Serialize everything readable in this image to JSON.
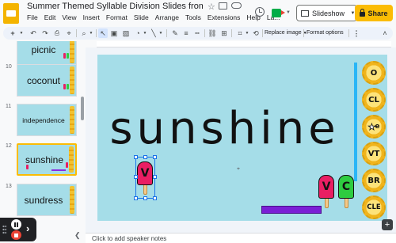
{
  "header": {
    "title": "Summer Themed Syllable Division Slides from Keep R...",
    "menu": [
      "File",
      "Edit",
      "View",
      "Insert",
      "Format",
      "Slide",
      "Arrange",
      "Tools",
      "Extensions",
      "Help",
      "La..."
    ],
    "slideshow_label": "Slideshow",
    "share_label": "Share"
  },
  "toolbar": {
    "replace_image": "Replace image",
    "format_options": "Format options"
  },
  "filmstrip": {
    "slides": [
      {
        "number": "",
        "word": "picnic"
      },
      {
        "number": "10",
        "word": "coconut"
      },
      {
        "number": "11",
        "word": "independence"
      },
      {
        "number": "12",
        "word": "sunshine"
      },
      {
        "number": "13",
        "word": "sundress"
      }
    ]
  },
  "slide": {
    "word": "sunshine",
    "popsicle_left_letter": "V",
    "popsicle_mid_letter": "V",
    "popsicle_right_letter": "C",
    "badges": [
      "O",
      "CL",
      "e",
      "VT",
      "BR",
      "CLE"
    ]
  },
  "notes": {
    "placeholder": "Click to add speaker notes"
  },
  "colors": {
    "slide_bg": "#a5dde8",
    "share_bg": "#fbbc04",
    "selection": "#1a73e8",
    "popsicle_pink": "#e91e63",
    "popsicle_green": "#2ecc40",
    "tray": "#7a1fd6"
  }
}
